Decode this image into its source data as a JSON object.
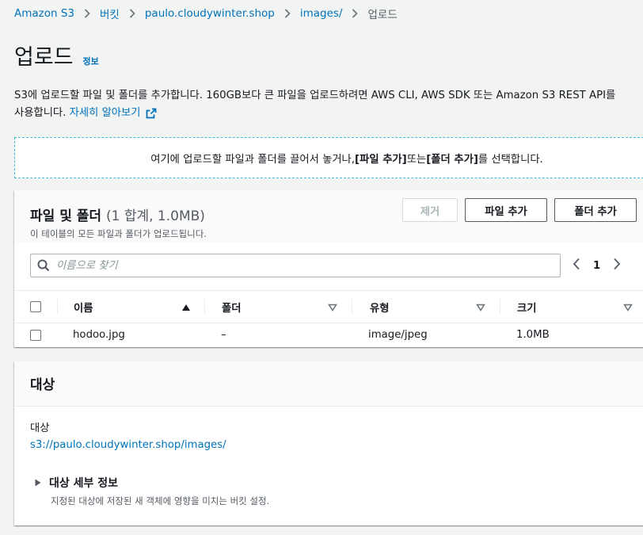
{
  "breadcrumb": {
    "items": [
      "Amazon S3",
      "버킷",
      "paulo.cloudywinter.shop",
      "images/"
    ],
    "current": "업로드"
  },
  "page": {
    "title": "업로드",
    "info_link": "정보",
    "description_line1": "S3에 업로드할 파일 및 폴더를 추가합니다. 160GB보다 큰 파일을 업로드하려면 AWS CLI, AWS SDK 또는 Amazon S3 REST API를",
    "description_line2": "사용합니다.",
    "learn_more": "자세히 알아보기"
  },
  "dropzone": {
    "text_before": "여기에 업로드할 파일과 폴더를 끌어서 놓거나, ",
    "add_files": "[파일 추가]",
    "text_mid": " 또는 ",
    "add_folder": "[폴더 추가]",
    "text_after": "를 선택합니다."
  },
  "files": {
    "title": "파일 및 폴더",
    "count": "(1 합계, 1.0MB)",
    "subtitle": "이 테이블의 모든 파일과 폴더가 업로드됩니다.",
    "remove_label": "제거",
    "add_files_label": "파일 추가",
    "add_folder_label": "폴더 추가",
    "search_placeholder": "이름으로 찾기",
    "page_number": "1",
    "columns": [
      "이름",
      "폴더",
      "유형",
      "크기"
    ],
    "rows": [
      {
        "name": "hodoo.jpg",
        "folder": "–",
        "type": "image/jpeg",
        "size": "1.0MB"
      }
    ]
  },
  "destination": {
    "title": "대상",
    "label": "대상",
    "path": "s3://paulo.cloudywinter.shop/images/",
    "details_title": "대상 세부 정보",
    "details_subtitle": "지정된 대상에 저장된 새 객체에 영향을 미치는 버킷 설정."
  },
  "colors": {
    "link": "#0073bb",
    "dropzone_border": "#44b9d6",
    "text": "#16191f",
    "muted": "#545b64"
  }
}
